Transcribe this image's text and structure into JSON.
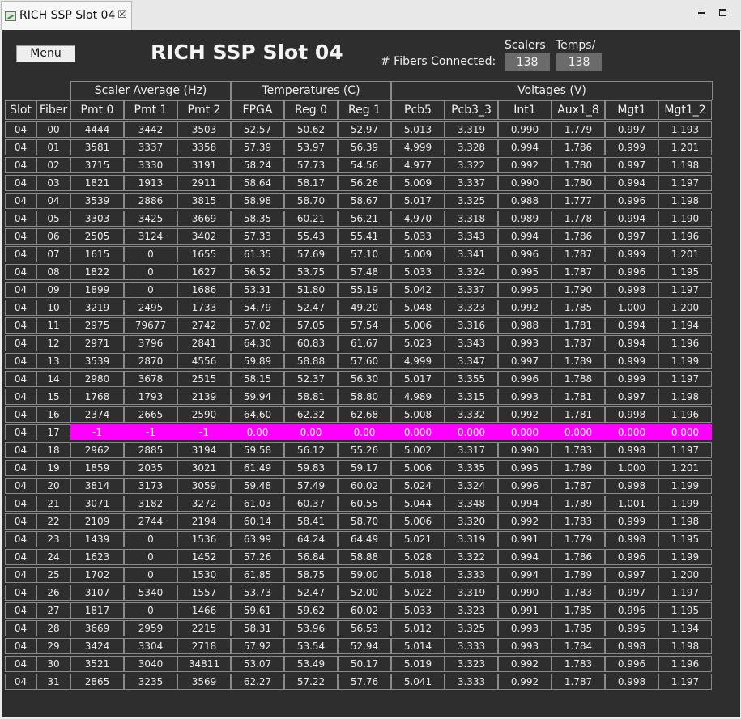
{
  "tab": {
    "title": "RICH SSP Slot 04"
  },
  "header": {
    "menu_label": "Menu",
    "title": "RICH SSP Slot 04",
    "fibers_label": "# Fibers Connected:",
    "scalers_label": "Scalers",
    "temps_label": "Temps/",
    "scalers_value": "138",
    "temps_value": "138"
  },
  "table": {
    "groups": [
      "Scaler Average  (Hz)",
      "Temperatures (C)",
      "Voltages (V)"
    ],
    "columns": [
      "Slot",
      "Fiber",
      "Pmt 0",
      "Pmt 1",
      "Pmt 2",
      "FPGA",
      "Reg 0",
      "Reg 1",
      "Pcb5",
      "Pcb3_3",
      "Int1",
      "Aux1_8",
      "Mgt1",
      "Mgt1_2"
    ],
    "highlight_color": "#ff00ff",
    "highlight_row_fiber": "17",
    "rows": [
      [
        "04",
        "00",
        "4444",
        "3442",
        "3503",
        "52.57",
        "50.62",
        "52.97",
        "5.013",
        "3.319",
        "0.990",
        "1.779",
        "0.997",
        "1.193"
      ],
      [
        "04",
        "01",
        "3581",
        "3337",
        "3358",
        "57.39",
        "53.97",
        "56.39",
        "4.999",
        "3.328",
        "0.994",
        "1.786",
        "0.999",
        "1.201"
      ],
      [
        "04",
        "02",
        "3715",
        "3330",
        "3191",
        "58.24",
        "57.73",
        "54.56",
        "4.977",
        "3.322",
        "0.992",
        "1.780",
        "0.997",
        "1.198"
      ],
      [
        "04",
        "03",
        "1821",
        "1913",
        "2911",
        "58.64",
        "58.17",
        "56.26",
        "5.009",
        "3.337",
        "0.990",
        "1.780",
        "0.994",
        "1.197"
      ],
      [
        "04",
        "04",
        "3539",
        "2886",
        "3815",
        "58.98",
        "58.70",
        "58.67",
        "5.017",
        "3.325",
        "0.988",
        "1.777",
        "0.996",
        "1.198"
      ],
      [
        "04",
        "05",
        "3303",
        "3425",
        "3669",
        "58.35",
        "60.21",
        "56.21",
        "4.970",
        "3.318",
        "0.989",
        "1.778",
        "0.994",
        "1.190"
      ],
      [
        "04",
        "06",
        "2505",
        "3124",
        "3402",
        "57.33",
        "55.43",
        "55.41",
        "5.033",
        "3.343",
        "0.994",
        "1.786",
        "0.997",
        "1.196"
      ],
      [
        "04",
        "07",
        "1615",
        "0",
        "1655",
        "61.35",
        "57.69",
        "57.10",
        "5.009",
        "3.341",
        "0.996",
        "1.787",
        "0.999",
        "1.201"
      ],
      [
        "04",
        "08",
        "1822",
        "0",
        "1627",
        "56.52",
        "53.75",
        "57.48",
        "5.033",
        "3.324",
        "0.995",
        "1.787",
        "0.996",
        "1.195"
      ],
      [
        "04",
        "09",
        "1899",
        "0",
        "1686",
        "53.31",
        "51.80",
        "55.19",
        "5.042",
        "3.337",
        "0.995",
        "1.790",
        "0.998",
        "1.197"
      ],
      [
        "04",
        "10",
        "3219",
        "2495",
        "1733",
        "54.79",
        "52.47",
        "49.20",
        "5.048",
        "3.323",
        "0.992",
        "1.785",
        "1.000",
        "1.200"
      ],
      [
        "04",
        "11",
        "2975",
        "79677",
        "2742",
        "57.02",
        "57.05",
        "57.54",
        "5.006",
        "3.316",
        "0.988",
        "1.781",
        "0.994",
        "1.194"
      ],
      [
        "04",
        "12",
        "2971",
        "3796",
        "2841",
        "64.30",
        "60.83",
        "61.67",
        "5.023",
        "3.343",
        "0.993",
        "1.787",
        "0.994",
        "1.196"
      ],
      [
        "04",
        "13",
        "3539",
        "2870",
        "4556",
        "59.89",
        "58.88",
        "57.60",
        "4.999",
        "3.347",
        "0.997",
        "1.789",
        "0.999",
        "1.199"
      ],
      [
        "04",
        "14",
        "2980",
        "3678",
        "2515",
        "58.15",
        "52.37",
        "56.30",
        "5.017",
        "3.355",
        "0.996",
        "1.788",
        "0.999",
        "1.197"
      ],
      [
        "04",
        "15",
        "1768",
        "1793",
        "2139",
        "59.94",
        "58.81",
        "58.80",
        "4.989",
        "3.315",
        "0.993",
        "1.781",
        "0.997",
        "1.198"
      ],
      [
        "04",
        "16",
        "2374",
        "2665",
        "2590",
        "64.60",
        "62.32",
        "62.68",
        "5.008",
        "3.332",
        "0.992",
        "1.781",
        "0.998",
        "1.196"
      ],
      [
        "04",
        "17",
        "-1",
        "-1",
        "-1",
        "0.00",
        "0.00",
        "0.00",
        "0.000",
        "0.000",
        "0.000",
        "0.000",
        "0.000",
        "0.000"
      ],
      [
        "04",
        "18",
        "2962",
        "2885",
        "3194",
        "59.58",
        "56.12",
        "55.26",
        "5.002",
        "3.317",
        "0.990",
        "1.783",
        "0.998",
        "1.197"
      ],
      [
        "04",
        "19",
        "1859",
        "2035",
        "3021",
        "61.49",
        "59.83",
        "59.17",
        "5.006",
        "3.335",
        "0.995",
        "1.789",
        "1.000",
        "1.201"
      ],
      [
        "04",
        "20",
        "3814",
        "3173",
        "3059",
        "59.48",
        "57.49",
        "60.02",
        "5.024",
        "3.324",
        "0.996",
        "1.787",
        "0.998",
        "1.199"
      ],
      [
        "04",
        "21",
        "3071",
        "3182",
        "3272",
        "61.03",
        "60.37",
        "60.55",
        "5.044",
        "3.348",
        "0.994",
        "1.789",
        "1.001",
        "1.199"
      ],
      [
        "04",
        "22",
        "2109",
        "2744",
        "2194",
        "60.14",
        "58.41",
        "58.70",
        "5.006",
        "3.320",
        "0.992",
        "1.783",
        "0.999",
        "1.198"
      ],
      [
        "04",
        "23",
        "1439",
        "0",
        "1536",
        "63.99",
        "64.24",
        "64.49",
        "5.021",
        "3.319",
        "0.991",
        "1.779",
        "0.998",
        "1.195"
      ],
      [
        "04",
        "24",
        "1623",
        "0",
        "1452",
        "57.26",
        "56.84",
        "58.88",
        "5.028",
        "3.322",
        "0.994",
        "1.786",
        "0.996",
        "1.199"
      ],
      [
        "04",
        "25",
        "1702",
        "0",
        "1530",
        "61.85",
        "58.75",
        "59.00",
        "5.018",
        "3.333",
        "0.994",
        "1.789",
        "0.997",
        "1.200"
      ],
      [
        "04",
        "26",
        "3107",
        "5340",
        "1557",
        "53.73",
        "52.47",
        "52.00",
        "5.022",
        "3.319",
        "0.990",
        "1.783",
        "0.997",
        "1.197"
      ],
      [
        "04",
        "27",
        "1817",
        "0",
        "1466",
        "59.61",
        "59.62",
        "60.02",
        "5.033",
        "3.323",
        "0.991",
        "1.785",
        "0.996",
        "1.195"
      ],
      [
        "04",
        "28",
        "3669",
        "2959",
        "2215",
        "58.31",
        "53.96",
        "56.53",
        "5.012",
        "3.325",
        "0.993",
        "1.785",
        "0.995",
        "1.194"
      ],
      [
        "04",
        "29",
        "3424",
        "3304",
        "2718",
        "57.92",
        "53.54",
        "52.94",
        "5.014",
        "3.333",
        "0.993",
        "1.784",
        "0.998",
        "1.198"
      ],
      [
        "04",
        "30",
        "3521",
        "3040",
        "34811",
        "53.07",
        "53.49",
        "50.17",
        "5.019",
        "3.323",
        "0.992",
        "1.783",
        "0.996",
        "1.196"
      ],
      [
        "04",
        "31",
        "2865",
        "3235",
        "3569",
        "62.27",
        "57.22",
        "57.76",
        "5.041",
        "3.333",
        "0.992",
        "1.787",
        "0.998",
        "1.197"
      ]
    ]
  }
}
